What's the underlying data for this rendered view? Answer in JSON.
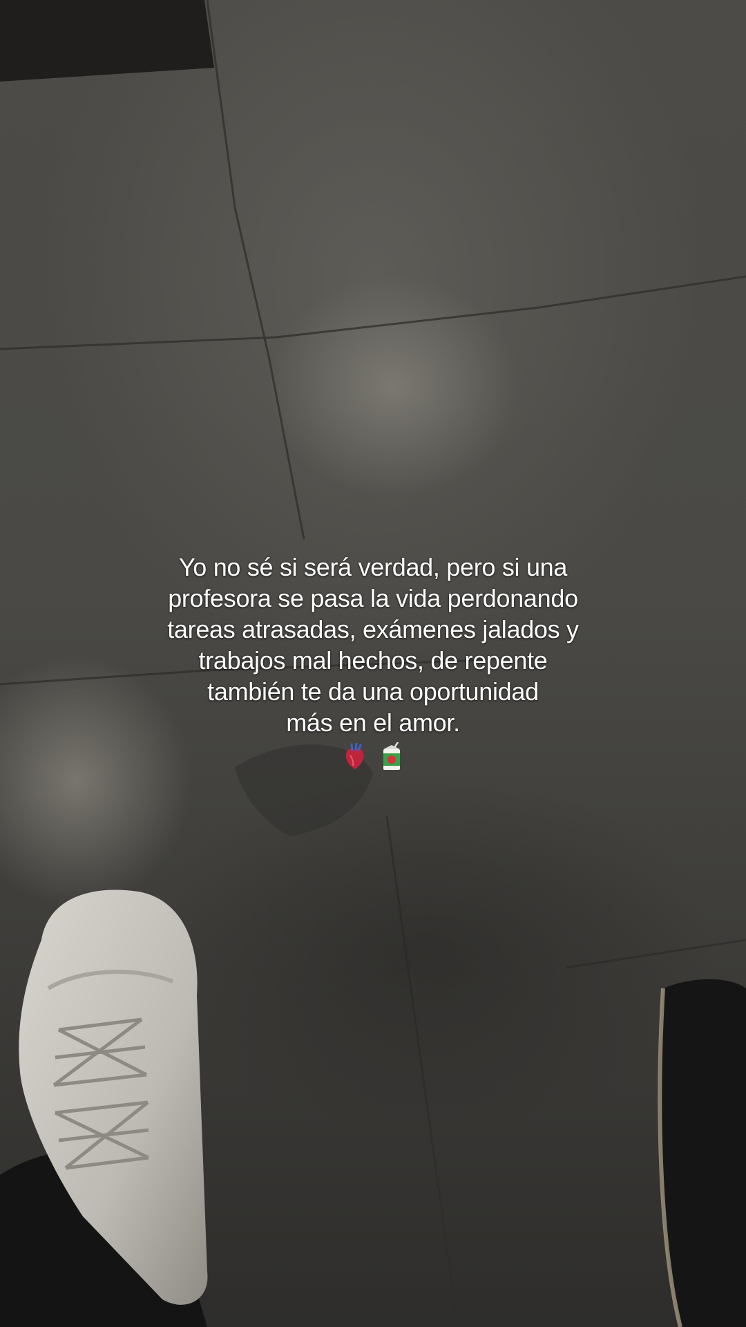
{
  "caption": {
    "lines": [
      "Yo no sé si será verdad, pero si una",
      "profesora se pasa la vida perdonando",
      "tareas atrasadas, exámenes jalados y",
      "trabajos mal hechos, de repente",
      "también te da una oportunidad",
      "más en el amor."
    ],
    "emojis": [
      "anatomical-heart-icon",
      "juice-box-icon"
    ]
  },
  "colors": {
    "text": "#ffffff",
    "floor": "#4a4945",
    "shoe": "#c9c6c0",
    "pants": "#161616"
  }
}
